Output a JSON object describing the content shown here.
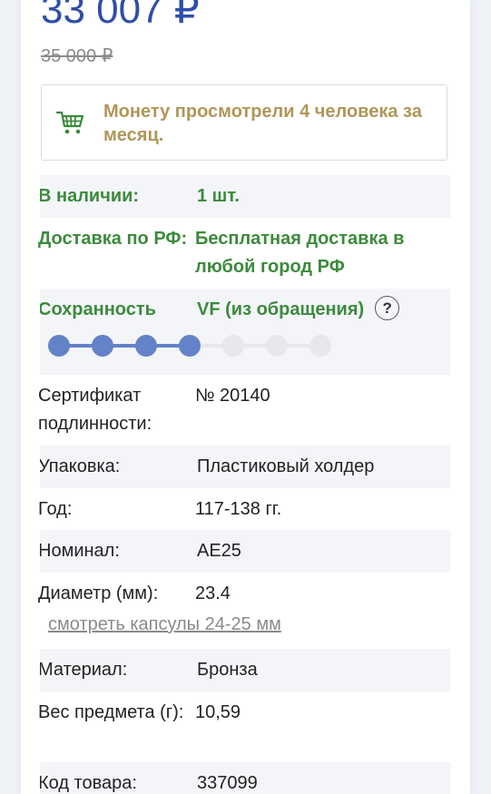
{
  "product": {
    "price": "33 007 ₽",
    "old_price": "35 000 ₽",
    "notice_icon": "cart-icon",
    "notice_text": "Монету просмотрели 4 человека за месяц."
  },
  "colors": {
    "price": "#2f4ea8",
    "notice": "#b09758",
    "label_green": "#3c8a3c",
    "scale_active": "#6482c8",
    "scale_inactive": "#e6e8ec"
  },
  "details": {
    "availability": {
      "label": "В наличии:",
      "value": "1 шт."
    },
    "delivery": {
      "label": "Доставка по РФ:",
      "value": "Бесплатная доставка в любой город РФ"
    },
    "condition": {
      "label": "Сохранность",
      "value": "VF (из обращения)",
      "help": "?",
      "level": 4,
      "levels_total": 7
    },
    "certificate": {
      "label": "Сертификат подлинности:",
      "value": "№ 20140"
    },
    "packaging": {
      "label": "Упаковка:",
      "value": "Пластиковый холдер"
    },
    "year": {
      "label": "Год:",
      "value": "117-138 гг."
    },
    "denomination": {
      "label": "Номинал:",
      "value": "AE25"
    },
    "diameter": {
      "label": "Диаметр (мм):",
      "value": "23.4",
      "link": "смотреть капсулы 24-25 мм"
    },
    "material": {
      "label": "Материал:",
      "value": "Бронза"
    },
    "weight": {
      "label": "Вес предмета (г):",
      "value": "10,59"
    },
    "sku": {
      "label": "Код товара:",
      "value": "337099"
    }
  }
}
